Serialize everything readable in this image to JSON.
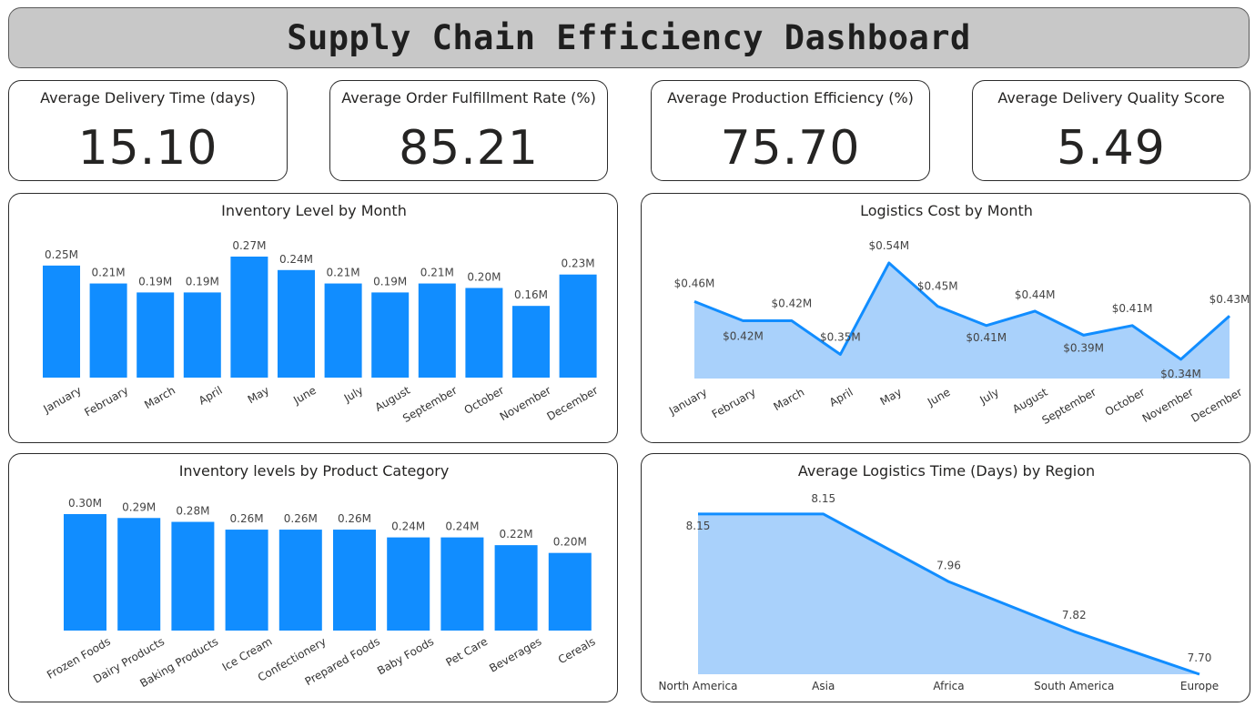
{
  "header": {
    "title": "Supply Chain Efficiency Dashboard"
  },
  "kpis": [
    {
      "label": "Average Delivery Time (days)",
      "value": "15.10"
    },
    {
      "label": "Average Order Fulfillment Rate (%)",
      "value": "85.21"
    },
    {
      "label": "Average Production Efficiency (%)",
      "value": "75.70"
    },
    {
      "label": "Average Delivery Quality Score",
      "value": "5.49"
    }
  ],
  "colors": {
    "bar": "#118DFF",
    "line": "#118DFF",
    "area": "#A9D1FB"
  },
  "chart_data": [
    {
      "type": "bar",
      "title": "Inventory Level by Month",
      "categories": [
        "January",
        "February",
        "March",
        "April",
        "May",
        "June",
        "July",
        "August",
        "September",
        "October",
        "November",
        "December"
      ],
      "values": [
        0.25,
        0.21,
        0.19,
        0.19,
        0.27,
        0.24,
        0.21,
        0.19,
        0.21,
        0.2,
        0.16,
        0.23
      ],
      "labels": [
        "0.25M",
        "0.21M",
        "0.19M",
        "0.19M",
        "0.27M",
        "0.24M",
        "0.21M",
        "0.19M",
        "0.21M",
        "0.20M",
        "0.16M",
        "0.23M"
      ],
      "ylim": [
        0,
        0.27
      ]
    },
    {
      "type": "area",
      "title": "Logistics Cost by Month",
      "categories": [
        "January",
        "February",
        "March",
        "April",
        "May",
        "June",
        "July",
        "August",
        "September",
        "October",
        "November",
        "December"
      ],
      "values": [
        0.46,
        0.42,
        0.42,
        0.35,
        0.54,
        0.45,
        0.41,
        0.44,
        0.39,
        0.41,
        0.34,
        0.43
      ],
      "labels": [
        "$0.46M",
        "$0.42M",
        "$0.42M",
        "$0.35M",
        "$0.54M",
        "$0.45M",
        "$0.41M",
        "$0.44M",
        "$0.39M",
        "$0.41M",
        "$0.34M",
        "$0.43M"
      ],
      "ylim": [
        0.3,
        0.54
      ]
    },
    {
      "type": "bar",
      "title": "Inventory levels by Product Category",
      "categories": [
        "Frozen Foods",
        "Dairy Products",
        "Baking Products",
        "Ice Cream",
        "Confectionery",
        "Prepared Foods",
        "Baby Foods",
        "Pet Care",
        "Beverages",
        "Cereals"
      ],
      "values": [
        0.3,
        0.29,
        0.28,
        0.26,
        0.26,
        0.26,
        0.24,
        0.24,
        0.22,
        0.2
      ],
      "labels": [
        "0.30M",
        "0.29M",
        "0.28M",
        "0.26M",
        "0.26M",
        "0.26M",
        "0.24M",
        "0.24M",
        "0.22M",
        "0.20M"
      ],
      "ylim": [
        0,
        0.3
      ]
    },
    {
      "type": "area",
      "title": "Average Logistics Time (Days) by Region",
      "categories": [
        "North America",
        "Asia",
        "Africa",
        "South America",
        "Europe"
      ],
      "values": [
        8.15,
        8.15,
        7.96,
        7.82,
        7.7
      ],
      "labels": [
        "8.15",
        "8.15",
        "7.96",
        "7.82",
        "7.70"
      ],
      "ylim": [
        7.7,
        8.16
      ]
    }
  ]
}
